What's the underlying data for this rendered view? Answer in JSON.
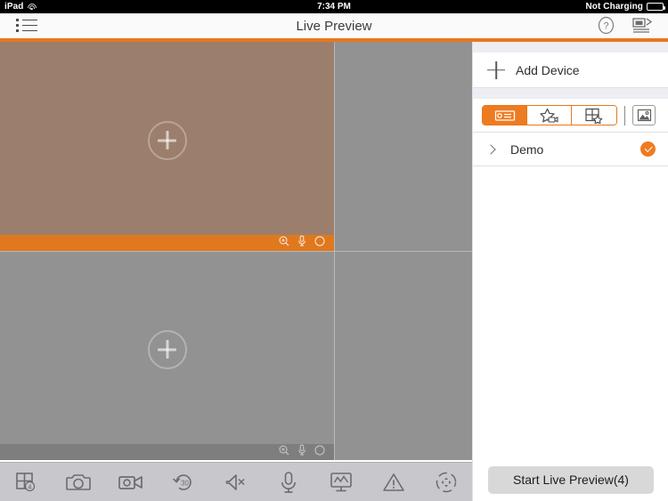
{
  "status_bar": {
    "device_label": "iPad",
    "wifi_icon": "wifi-icon",
    "time": "7:34 PM",
    "battery_text": "Not Charging",
    "battery_icon": "battery-icon"
  },
  "nav_bar": {
    "menu_icon": "list-menu-icon",
    "title": "Live Preview",
    "help_icon": "help-question-icon",
    "device_stream_icon": "device-stream-icon"
  },
  "colors": {
    "accent_orange": "#e8771d",
    "selected_cell": "#9b7f6c",
    "empty_cell": "#929292",
    "toolbar_bg": "#c7c7cc"
  },
  "video_grid": {
    "window_count": 4,
    "cells": [
      {
        "name": "cell-top-left",
        "selected": true,
        "placeholder_icon": "add-channel-plus-icon",
        "bar_icons": [
          "zoom-in-icon",
          "microphone-icon",
          "circle-icon"
        ]
      },
      {
        "name": "cell-top-right",
        "selected": false,
        "placeholder_icon": "",
        "bar_icons": []
      },
      {
        "name": "cell-bottom-left",
        "selected": false,
        "placeholder_icon": "add-channel-plus-icon",
        "bar_icons": [
          "zoom-in-icon",
          "microphone-icon",
          "circle-icon"
        ]
      },
      {
        "name": "cell-bottom-right",
        "selected": false,
        "placeholder_icon": "",
        "bar_icons": []
      }
    ]
  },
  "bottom_toolbar": {
    "items": [
      {
        "name": "window-division-button",
        "icon": "window-division-4-icon",
        "badge": "4"
      },
      {
        "name": "snapshot-button",
        "icon": "camera-icon"
      },
      {
        "name": "record-button",
        "icon": "video-record-icon"
      },
      {
        "name": "instant-playback-button",
        "icon": "rewind-30-icon",
        "badge": "30"
      },
      {
        "name": "audio-button",
        "icon": "speaker-mute-icon"
      },
      {
        "name": "two-way-audio-button",
        "icon": "microphone-icon"
      },
      {
        "name": "quality-button",
        "icon": "monitor-graph-icon"
      },
      {
        "name": "alarm-button",
        "icon": "warning-triangle-icon"
      },
      {
        "name": "ptz-button",
        "icon": "ptz-circle-icon"
      }
    ]
  },
  "sidebar": {
    "add_device": {
      "label": "Add Device",
      "icon": "plus-icon"
    },
    "segmented": {
      "options": [
        {
          "name": "segment-device-list",
          "icon": "device-nvr-icon",
          "active": true
        },
        {
          "name": "segment-favorites",
          "icon": "star-camera-icon",
          "active": false
        },
        {
          "name": "segment-custom-view",
          "icon": "grid-star-icon",
          "active": false
        }
      ],
      "extra_button": {
        "name": "picture-button",
        "icon": "picture-icon"
      }
    },
    "devices": [
      {
        "name": "Demo",
        "expand_icon": "chevron-right-icon",
        "selected": true,
        "check_icon": "check-badge-icon"
      }
    ],
    "start_button_label": "Start Live Preview(4)"
  }
}
